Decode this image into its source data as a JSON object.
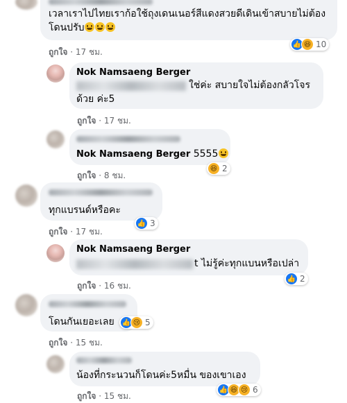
{
  "comments": [
    {
      "text": "เวลาเราไปไทยเราก้อใช้ถุงเดนเนอร์สีแดงสวยดีเดินเข้าสบายไม่ต้องโดนปรับ",
      "emoji_count": 3,
      "like": "ถูกใจ",
      "time": "17 ชม.",
      "reactions": [
        "like-icon",
        "haha-icon"
      ],
      "reaction_count": "10"
    },
    {
      "author": "Nok Namsaeng Berger",
      "text": "ใช่ค่ะ สบายใจไม่ต้องกลัวโจร ด้วย ค่ะ5",
      "like": "ถูกใจ",
      "time": "17 ชม."
    },
    {
      "author": "Nok Namsaeng Berger",
      "text_suffix": "5555",
      "like": "ถูกใจ",
      "time": "8 ชม.",
      "reactions": [
        "haha-icon"
      ],
      "reaction_count": "2"
    },
    {
      "text": "ทุกแบรนด์หรือคะ",
      "like": "ถูกใจ",
      "time": "17 ชม.",
      "reactions": [
        "like-icon"
      ],
      "reaction_count": "3"
    },
    {
      "author": "Nok Namsaeng Berger",
      "text_suffix": "t ไม่รู้ค่ะทุกแบนหรือเปล่า",
      "like": "ถูกใจ",
      "time": "16 ชม.",
      "reactions": [
        "like-icon"
      ],
      "reaction_count": "2"
    },
    {
      "text": "โดนกันเยอะเลย",
      "like": "ถูกใจ",
      "time": "15 ชม.",
      "reactions": [
        "like-icon",
        "sad-icon"
      ],
      "reaction_count": "5"
    },
    {
      "text": "น้องที่กระนวนก็โดนค่ะ5หมื่น ของเขาเอง",
      "like": "ถูกใจ",
      "time": "15 ชม.",
      "reactions": [
        "like-icon",
        "haha-icon",
        "sad-icon"
      ],
      "reaction_count": "6"
    }
  ]
}
